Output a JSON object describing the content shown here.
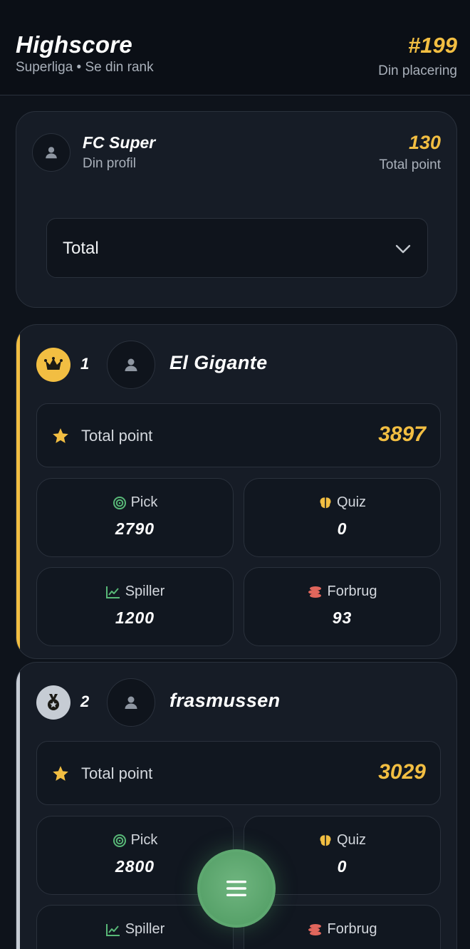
{
  "header": {
    "title": "Highscore",
    "subtitle": "Superliga • Se din rank",
    "rank": "#199",
    "rank_label": "Din placering"
  },
  "profile": {
    "name": "FC Super",
    "sub": "Din profil",
    "points": "130",
    "points_label": "Total point",
    "filter": {
      "selected": "Total"
    }
  },
  "labels": {
    "total_point": "Total point",
    "pick": "Pick",
    "quiz": "Quiz",
    "spiller": "Spiller",
    "forbrug": "Forbrug"
  },
  "players": [
    {
      "rank": "1",
      "name": "El Gigante",
      "total": "3897",
      "pick": "2790",
      "quiz": "0",
      "spiller": "1200",
      "forbrug": "93",
      "medal": "crown-icon",
      "accent": "#f2be42"
    },
    {
      "rank": "2",
      "name": "frasmussen",
      "total": "3029",
      "pick": "2800",
      "quiz": "0",
      "spiller": "",
      "forbrug": "",
      "medal": "medal-icon",
      "accent": "#c6ccd4"
    }
  ],
  "colors": {
    "gold": "#f2be42",
    "silver": "#c6ccd4",
    "fab": "#5ea870"
  }
}
